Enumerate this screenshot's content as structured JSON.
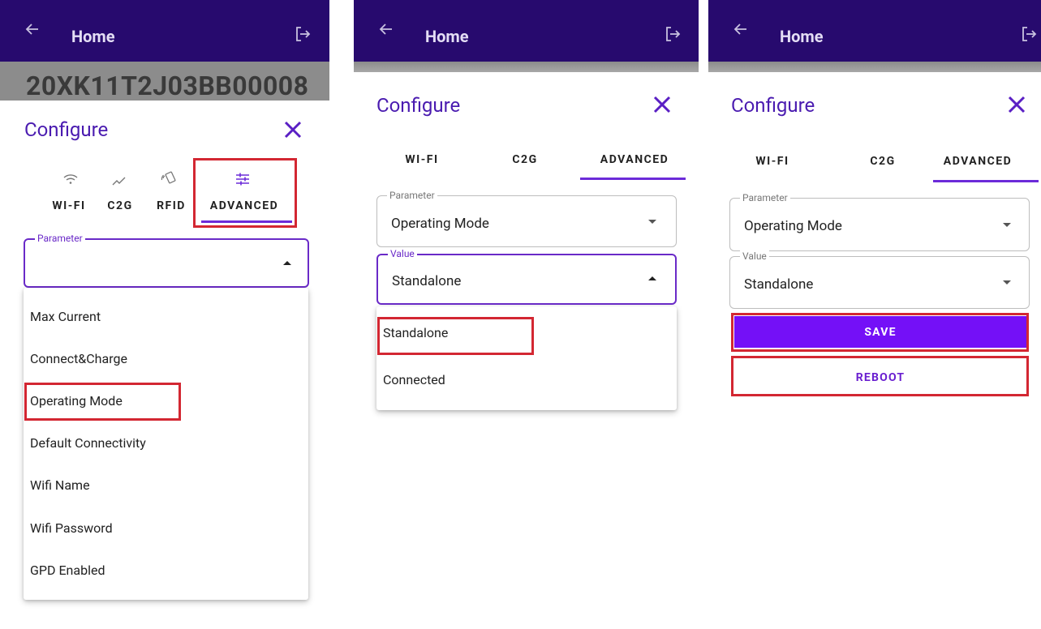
{
  "appbar": {
    "title": "Home"
  },
  "serial": "20XK11T2J03BB00008",
  "dialog": {
    "title": "Configure"
  },
  "tabs_full": [
    {
      "label": "WI-FI",
      "icon": "wifi-icon"
    },
    {
      "label": "C2G",
      "icon": "chart-line-icon"
    },
    {
      "label": "RFID",
      "icon": "rfid-card-icon"
    },
    {
      "label": "ADVANCED",
      "icon": "tune-sliders-icon"
    }
  ],
  "tabs_short": [
    "WI-FI",
    "C2G",
    "ADVANCED"
  ],
  "parameter": {
    "label": "Parameter",
    "value": "Operating Mode"
  },
  "value_field": {
    "label": "Value",
    "value": "Standalone"
  },
  "parameter_options": [
    "Max Current",
    "Connect&Charge",
    "Operating Mode",
    "Default Connectivity",
    "Wifi Name",
    "Wifi Password",
    "GPD Enabled"
  ],
  "value_options": [
    "Standalone",
    "Connected"
  ],
  "buttons": {
    "save": "SAVE",
    "reboot": "REBOOT"
  },
  "colors": {
    "appbar": "#270a6e",
    "accent": "#6c2bd9",
    "save_button": "#7410f7",
    "highlight_box": "#d32732"
  }
}
